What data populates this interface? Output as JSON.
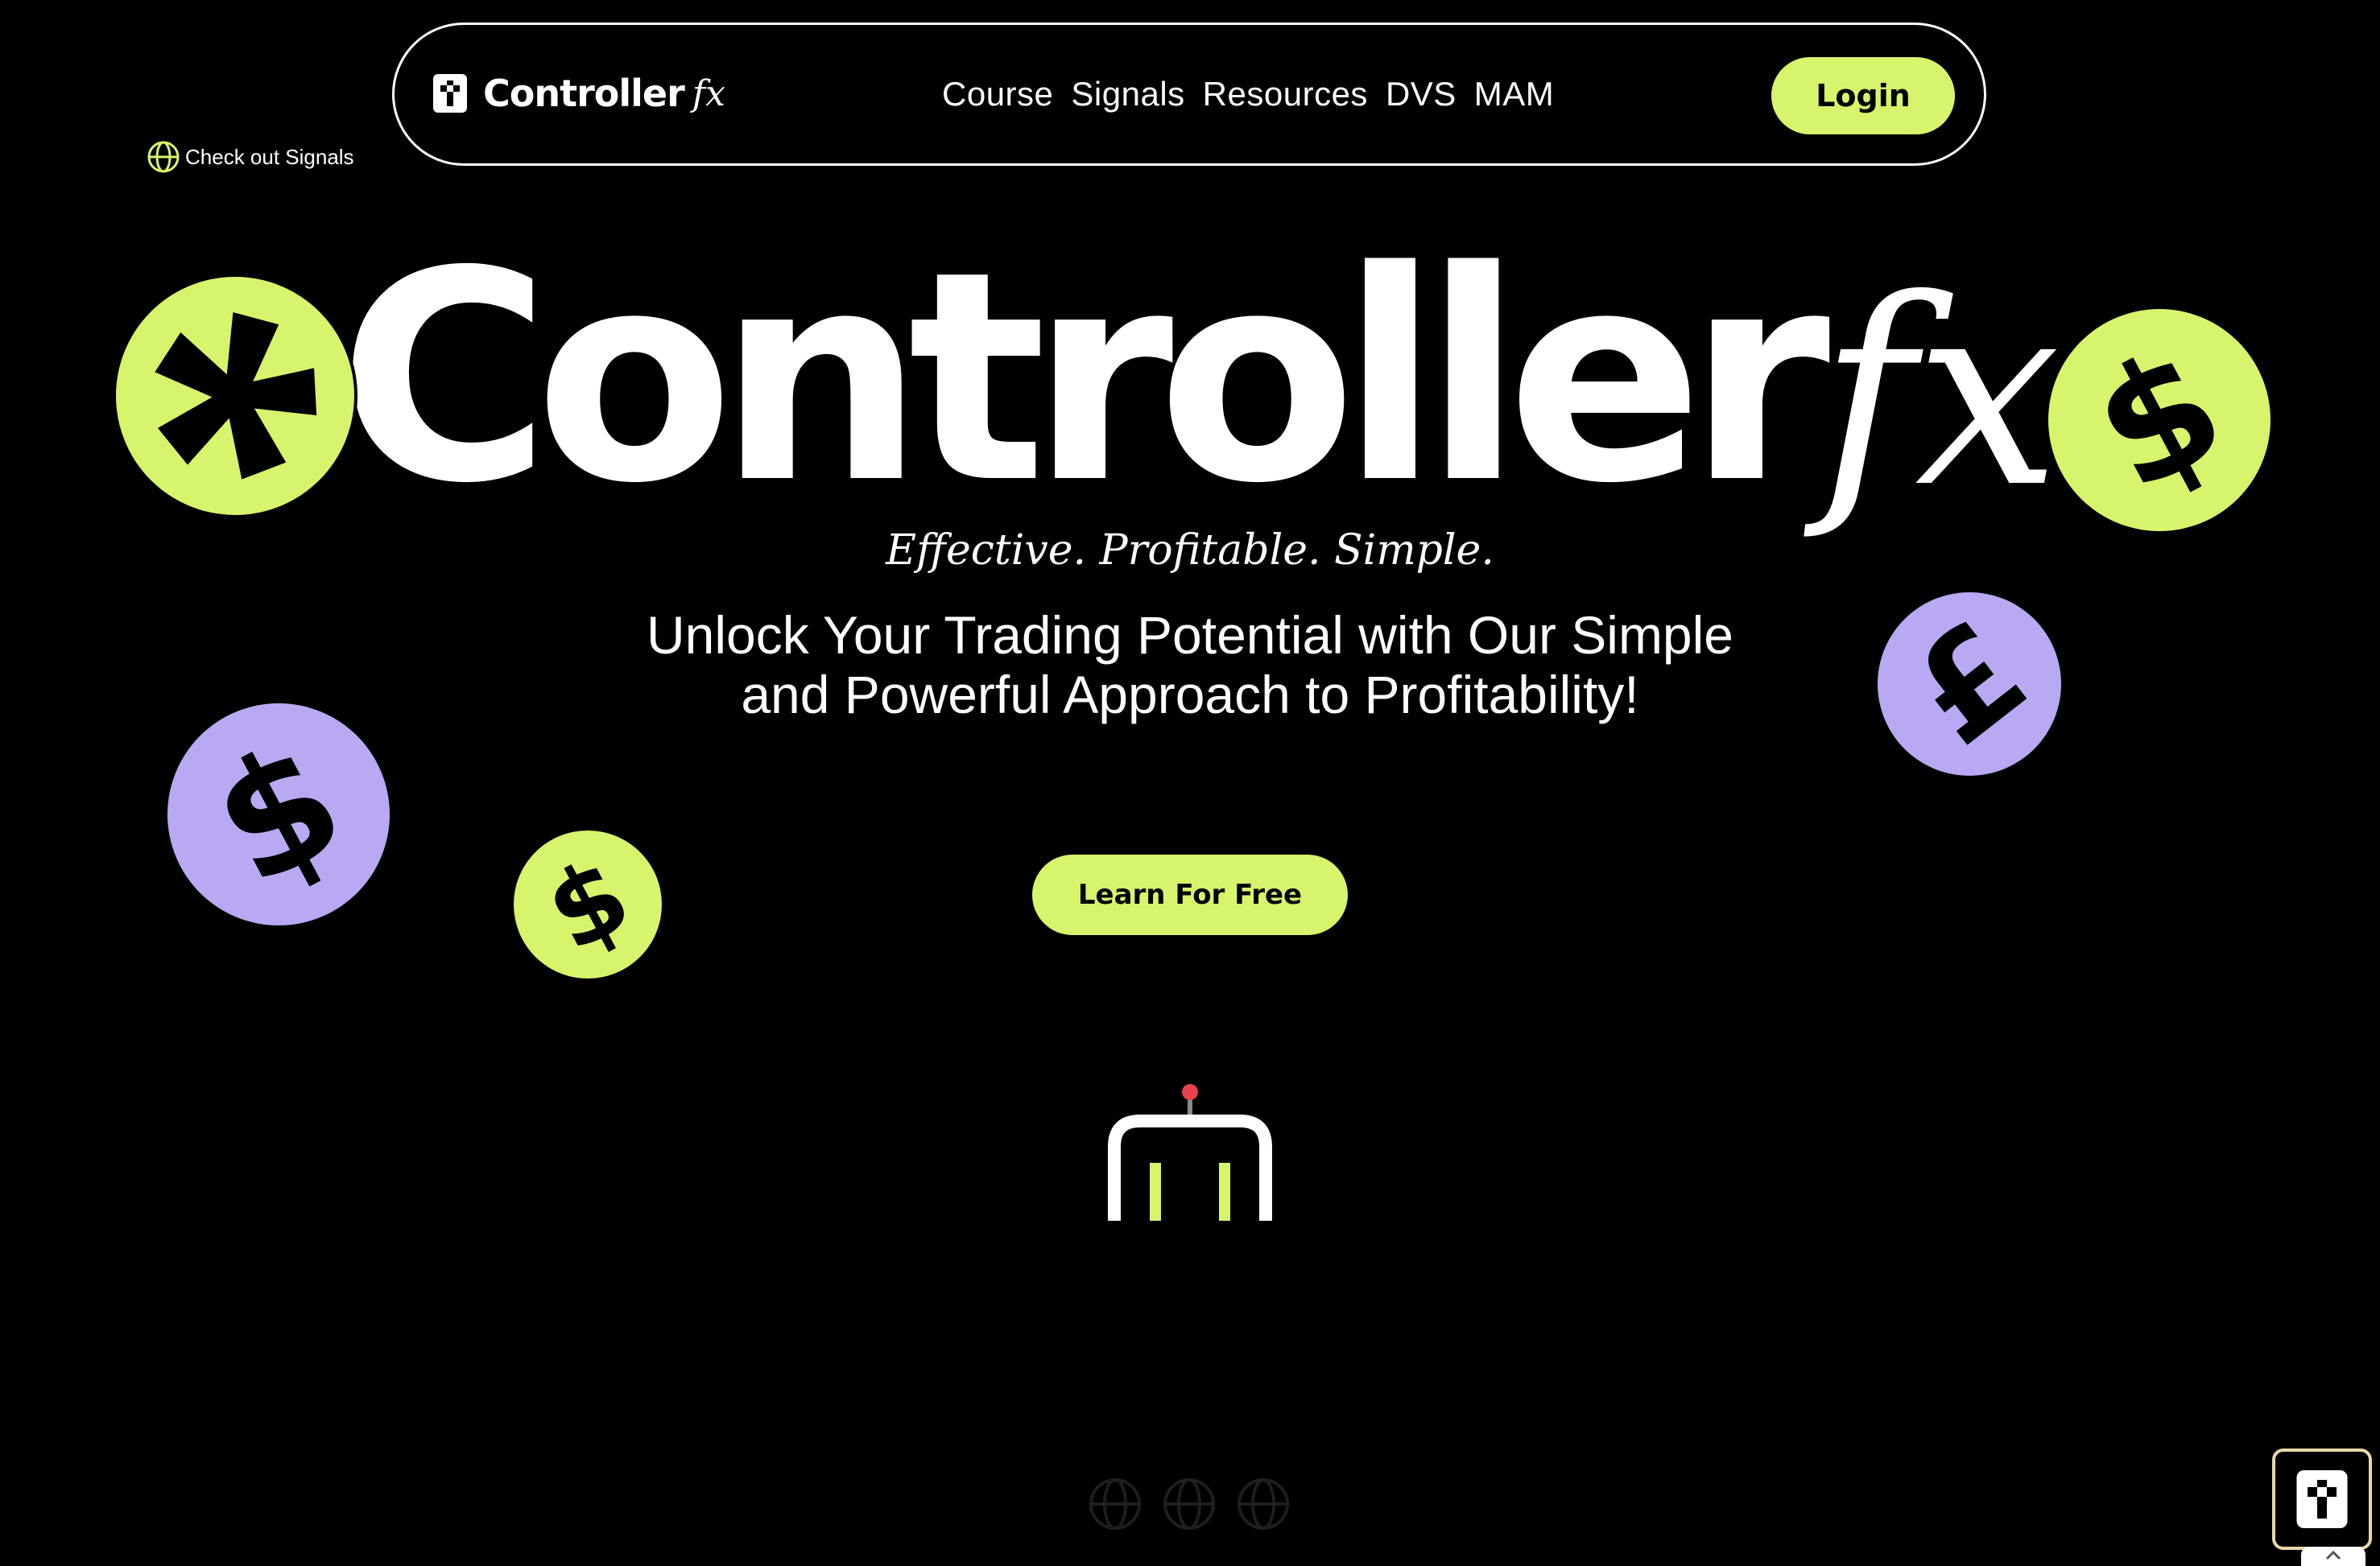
{
  "brand": {
    "name": "Controller",
    "fx": "fx"
  },
  "nav": {
    "links": [
      "Course",
      "Signals",
      "Resources",
      "DVS",
      "MAM"
    ],
    "login_label": "Login"
  },
  "promo": {
    "label": "Check out Signals",
    "icon": "globe-icon"
  },
  "hero": {
    "title": "Controller",
    "title_fx": "fx",
    "tagline": "Effective. Profitable. Simple.",
    "subhead_line1": "Unlock Your Trading Potential with Our Simple",
    "subhead_line2": "and Powerful Approach to Profitability!",
    "cta_label": "Learn For Free"
  },
  "coins": {
    "dollar": "$",
    "pound": "£"
  },
  "colors": {
    "background": "#000000",
    "accent_lime": "#d6f56c",
    "accent_purple": "#b9a8f2",
    "text": "#ffffff",
    "robot_light": "#e8424f"
  }
}
